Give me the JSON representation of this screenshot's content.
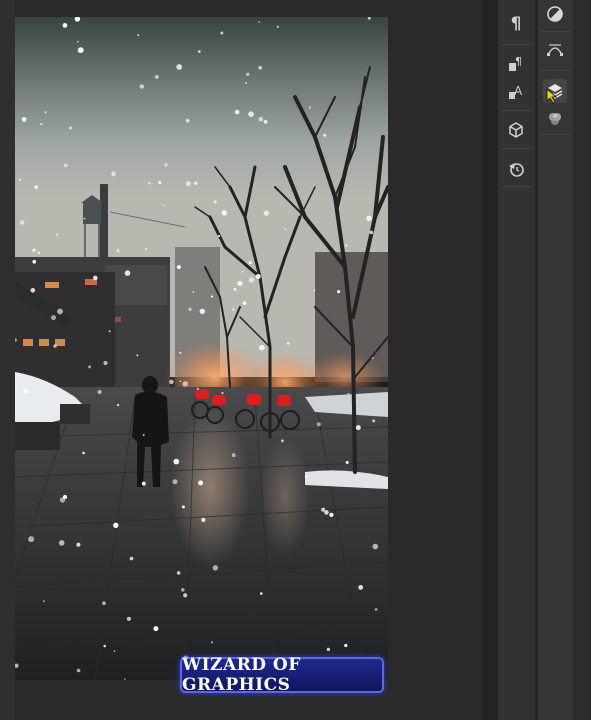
{
  "app": {
    "name": "photo-editor"
  },
  "canvas": {
    "scene": "snowy-city-street-at-night",
    "watermark_text": "WIZARD OF GRAPHICS"
  },
  "panel_left": {
    "tools": [
      {
        "name": "paragraph",
        "icon": "pilcrow-icon"
      },
      {
        "name": "paragraph-styles",
        "icon": "paragraph-styles-icon"
      },
      {
        "name": "character-styles",
        "icon": "character-styles-icon"
      },
      {
        "name": "3d",
        "icon": "cube-icon"
      },
      {
        "name": "history",
        "icon": "history-icon"
      }
    ]
  },
  "panel_right": {
    "tools": [
      {
        "name": "adjustments",
        "icon": "adjustments-icon"
      },
      {
        "name": "paths",
        "icon": "pen-path-icon"
      },
      {
        "name": "layers",
        "icon": "layers-icon",
        "active": true
      },
      {
        "name": "channels",
        "icon": "channels-icon"
      }
    ]
  },
  "colors": {
    "watermark_bg": "#1a2380",
    "watermark_border": "#5b66e8",
    "panel_bg": "#323232"
  }
}
